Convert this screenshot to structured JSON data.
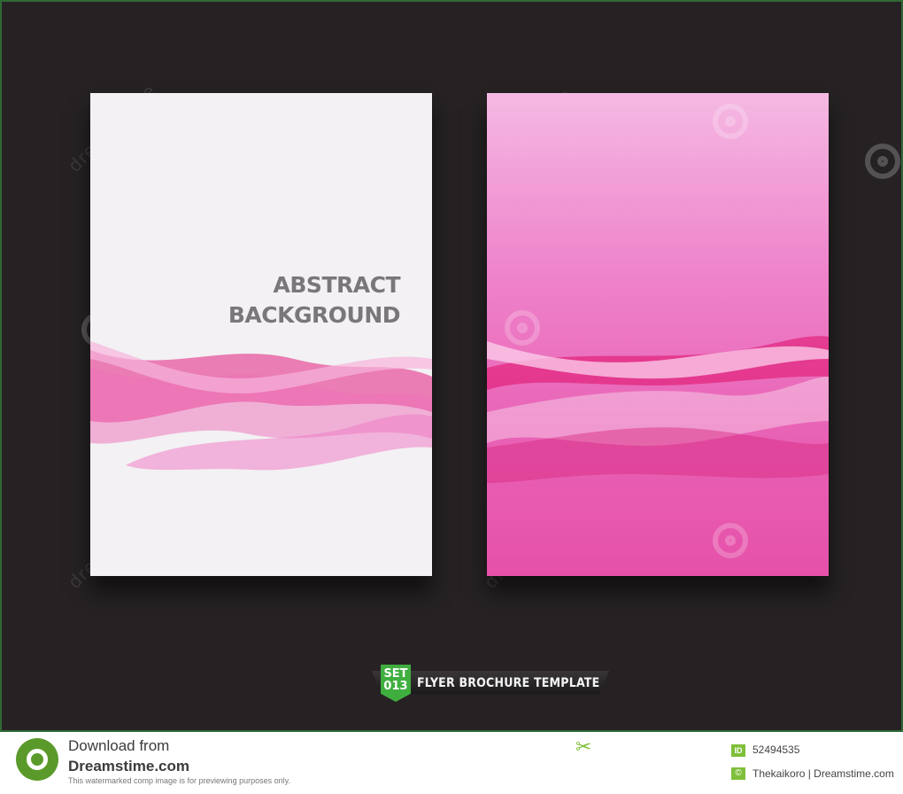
{
  "flyer_left": {
    "title_line1": "ABSTRACT",
    "title_line2": "BACKGROUND"
  },
  "ribbon": {
    "badge_line1": "SET",
    "badge_line2": "013",
    "label": "FLYER BROCHURE TEMPLATE"
  },
  "watermark": {
    "text": "dreamstime"
  },
  "footer": {
    "download_label": "Download from",
    "site": "Dreamstime.com",
    "note": "This watermarked comp image is for previewing purposes only.",
    "id_label": "ID",
    "id_number": "52494535",
    "copyright_symbol": "©",
    "credit": "Thekaikoro | Dreamstime.com"
  },
  "colors": {
    "frame_bg": "#262224",
    "frame_border": "#2f6a35",
    "pink_dark": "#e21d7d",
    "pink_mid": "#ee6fb9",
    "pink_light": "#f5b9e3",
    "badge_green": "#3fae3f"
  },
  "icons": [
    "dreamstime-spiral-icon",
    "scissors-icon"
  ]
}
